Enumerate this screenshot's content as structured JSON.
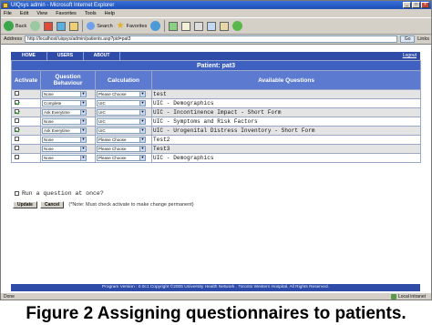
{
  "window": {
    "title": "UIQsys admin - Microsoft Internet Explorer"
  },
  "menubar": [
    "File",
    "Edit",
    "View",
    "Favorites",
    "Tools",
    "Help"
  ],
  "toolbar": {
    "back_label": "Back",
    "search_label": "Search",
    "favorites_label": "Favorites"
  },
  "addressbar": {
    "label": "Address",
    "url": "http://localhost/uiqsys/admin/patients.asp?pid=pat3",
    "go_label": "Go",
    "links_label": "Links"
  },
  "nav": {
    "tabs": [
      "HOME",
      "USERS",
      "ABOUT"
    ],
    "logout": "Logout"
  },
  "patient_title": "Patient: pat3",
  "columns": {
    "activate": "Activate",
    "behaviour": "Question Behaviour",
    "calculation": "Calculation",
    "questions": "Available Questions"
  },
  "rows": [
    {
      "active": false,
      "behaviour": "None",
      "calculation": "Please Choose",
      "question": "test"
    },
    {
      "active": true,
      "behaviour": "Complete",
      "calculation": "UIC",
      "question": "UIC - Demographics"
    },
    {
      "active": true,
      "behaviour": "Ask Everytime",
      "calculation": "UIC",
      "question": "UIC - Incontinence Impact - Short Form"
    },
    {
      "active": false,
      "behaviour": "None",
      "calculation": "UIC",
      "question": "UIC - Symptoms and Risk Factors"
    },
    {
      "active": true,
      "behaviour": "Ask Everytime",
      "calculation": "UIC",
      "question": "UIC - Urogenital Distress Inventory - Short Form"
    },
    {
      "active": false,
      "behaviour": "None",
      "calculation": "Please Choose",
      "question": "Test2"
    },
    {
      "active": false,
      "behaviour": "None",
      "calculation": "Please Choose",
      "question": "Test3"
    },
    {
      "active": false,
      "behaviour": "None",
      "calculation": "Please Choose",
      "question": "UIC - Demographics"
    }
  ],
  "run_once_label": "Run a question at once?",
  "buttons": {
    "update": "Update",
    "cancel": "Cancel"
  },
  "note": "(*Note: Must check activate to make change permanent)",
  "footer_text": "Program Version : 0.0c1 Copyright ©2005 University Health Network . Toronto Western Hospital. All Rights Reserved.",
  "status": {
    "left": "Done",
    "zone": "Local intranet"
  },
  "caption": "Figure 2 Assigning questionnaires to patients."
}
